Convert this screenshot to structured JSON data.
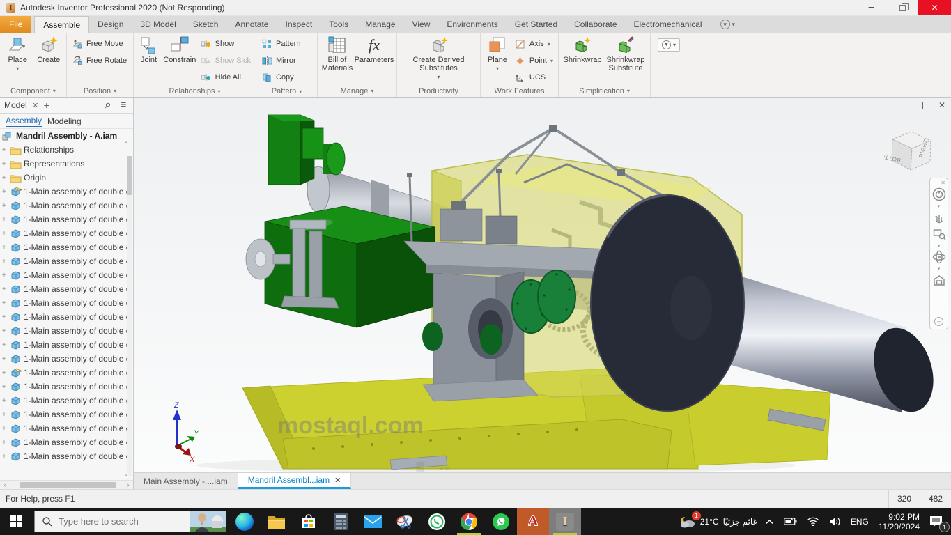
{
  "colors": {
    "accent": "#0696d7",
    "file_tab_orange": "#e8972f",
    "close_red": "#e81123",
    "taskbar_dark": "#181818",
    "autocad_tile": "#c05a28",
    "viewport_yellow": "#cdd232",
    "motor_green": "#0e6e0e"
  },
  "window": {
    "title": "Autodesk Inventor Professional 2020 (Not Responding)",
    "app_letter": "I"
  },
  "menu": {
    "file": "File",
    "tabs": [
      {
        "label": "Assemble",
        "cls": "active"
      },
      {
        "label": "Design"
      },
      {
        "label": "3D Model"
      },
      {
        "label": "Sketch"
      },
      {
        "label": "Annotate"
      },
      {
        "label": "Inspect"
      },
      {
        "label": "Tools"
      },
      {
        "label": "Manage"
      },
      {
        "label": "View"
      },
      {
        "label": "Environments"
      },
      {
        "label": "Get Started"
      },
      {
        "label": "Collaborate"
      },
      {
        "label": "Electromechanical"
      }
    ]
  },
  "ribbon": {
    "component": {
      "label": "Component",
      "place": "Place",
      "create": "Create"
    },
    "position": {
      "label": "Position",
      "free_move": "Free Move",
      "free_rotate": "Free Rotate"
    },
    "relationships": {
      "label": "Relationships",
      "joint": "Joint",
      "constrain": "Constrain",
      "show": "Show",
      "show_sick": "Show Sick",
      "hide_all": "Hide All"
    },
    "pattern": {
      "label": "Pattern",
      "pattern": "Pattern",
      "mirror": "Mirror",
      "copy": "Copy"
    },
    "manage": {
      "label": "Manage",
      "bom": "Bill of Materials",
      "parameters": "Parameters"
    },
    "productivity": {
      "label": "Productivity",
      "create_derived": "Create Derived Substitutes"
    },
    "work_features": {
      "label": "Work Features",
      "plane": "Plane",
      "axis": "Axis",
      "point": "Point",
      "ucs": "UCS"
    },
    "simplification": {
      "label": "Simplification",
      "shrinkwrap": "Shrinkwrap",
      "shrinkwrap_substitute": "Shrinkwrap Substitute"
    }
  },
  "browser": {
    "panel_title": "Model",
    "tabs": [
      {
        "label": "Assembly",
        "cls": "active"
      },
      {
        "label": "Modeling"
      }
    ],
    "tab_separator": "|",
    "root": "Mandril Assembly - A.iam",
    "folders": [
      {
        "label": "Relationships"
      },
      {
        "label": "Representations",
        "cls": "rep"
      },
      {
        "label": "Origin"
      }
    ],
    "items": [
      {
        "label": "1-Main assembly of double c",
        "cls": "edit"
      },
      {
        "label": "1-Main assembly of double c"
      },
      {
        "label": "1-Main assembly of double c"
      },
      {
        "label": "1-Main assembly of double c"
      },
      {
        "label": "1-Main assembly of double c"
      },
      {
        "label": "1-Main assembly of double c"
      },
      {
        "label": "1-Main assembly of double c"
      },
      {
        "label": "1-Main assembly of double c"
      },
      {
        "label": "1-Main assembly of double c"
      },
      {
        "label": "1-Main assembly of double c"
      },
      {
        "label": "1-Main assembly of double c"
      },
      {
        "label": "1-Main assembly of double c"
      },
      {
        "label": "1-Main assembly of double c"
      },
      {
        "label": "1-Main assembly of double c",
        "cls": "edit"
      },
      {
        "label": "1-Main assembly of double c"
      },
      {
        "label": "1-Main assembly of double c"
      },
      {
        "label": "1-Main assembly of double c"
      },
      {
        "label": "1-Main assembly of double c"
      },
      {
        "label": "1-Main assembly of double c"
      },
      {
        "label": "1-Main assembly of double c"
      }
    ]
  },
  "viewport": {
    "viewcube": {
      "right": "RIGHT",
      "bottom": "BOTTOM"
    },
    "triad": {
      "x": "X",
      "y": "Y",
      "z": "Z"
    },
    "watermark": {
      "arabic": "مستقل",
      "latin": "mostaql.com"
    }
  },
  "doc_tabs": [
    {
      "label": "Main Assembly -....iam"
    },
    {
      "label": "Mandril Assembl...iam",
      "cls": "active",
      "close": "✕"
    }
  ],
  "status": {
    "help": "For Help, press F1",
    "coords": [
      "320",
      "482"
    ]
  },
  "taskbar": {
    "search_placeholder": "Type here to search",
    "icons": [
      "start",
      "search",
      "edge",
      "file-explorer",
      "store",
      "calculator",
      "mail",
      "snipping-tool",
      "whatsapp-light",
      "chrome",
      "whatsapp",
      "autocad",
      "inventor"
    ],
    "autocad_letter": "A",
    "inventor_letter": "I",
    "tray": {
      "weather_badge": "1",
      "temp": "21°C",
      "condition": "غائم جزئيًا",
      "lang": "ENG",
      "time": "9:02 PM",
      "date": "11/20/2024",
      "notif_badge": "1"
    }
  }
}
